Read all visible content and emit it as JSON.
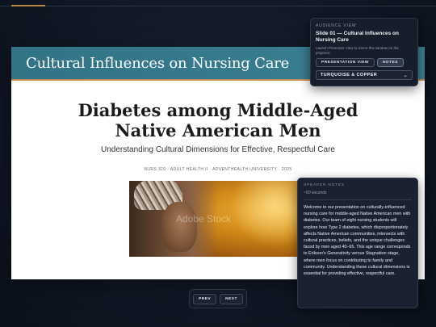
{
  "progress": {
    "fraction": 0.08,
    "accent_color": "#b9894c"
  },
  "slide": {
    "header": "Cultural Influences on Nursing Care",
    "title_line1": "Diabetes among Middle-Aged",
    "title_line2": "Native American Men",
    "subtitle": "Understanding Cultural Dimensions for Effective, Respectful Care",
    "meta": "NURS 320 · ADULT HEALTH II · ADVENTHEALTH UNIVERSITY · 2025",
    "image_watermark": "Adobe Stock",
    "header_color": "#327386",
    "accent_color": "#c69251"
  },
  "audience_panel": {
    "eyebrow": "AUDIENCE VIEW",
    "title": "Slide 01 — Cultural Influences on Nursing Care",
    "description": "Launch Presenter View to mirror this window on the projector.",
    "presentation_button": "PRESENTATION VIEW",
    "notes_button": "NOTES",
    "theme_value": "TURQUOISE & COPPER",
    "theme_icon": "chevron-down-icon"
  },
  "speaker_notes": {
    "eyebrow": "SPEAKER NOTES",
    "duration": "~60 seconds",
    "body": "Welcome to our presentation on culturally-influenced nursing care for middle-aged Native American men with diabetes. Our team of eight nursing students will explore how Type 2 diabetes, which disproportionately affects Native American communities, intersects with cultural practices, beliefs, and the unique challenges faced by men aged 40–65. This age range corresponds to Erikson's Generativity versus Stagnation stage, where men focus on contributing to family and community. Understanding these cultural dimensions is essential for providing effective, respectful care."
  },
  "navigation": {
    "prev": "PREV",
    "next": "NEXT"
  }
}
